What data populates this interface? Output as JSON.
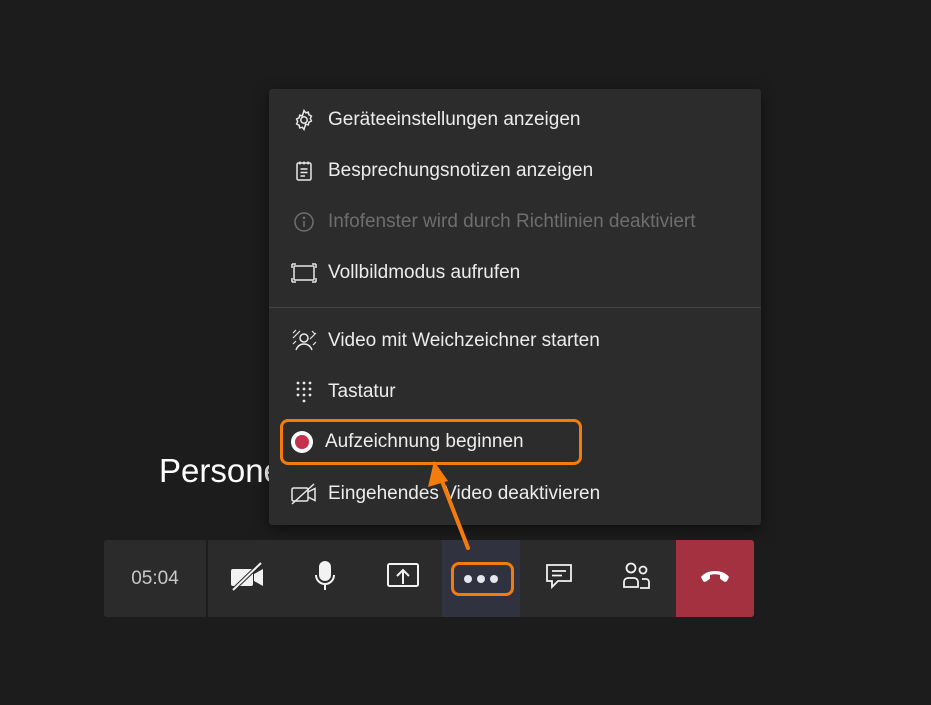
{
  "participant": {
    "name": "Persone"
  },
  "menu": {
    "items": [
      {
        "label": "Geräteeinstellungen anzeigen",
        "icon": "gear-icon",
        "disabled": false
      },
      {
        "label": "Besprechungsnotizen anzeigen",
        "icon": "notes-icon",
        "disabled": false
      },
      {
        "label": "Infofenster wird durch Richtlinien deaktiviert",
        "icon": "info-icon",
        "disabled": true
      },
      {
        "label": "Vollbildmodus aufrufen",
        "icon": "fullscreen-icon",
        "disabled": false
      },
      {
        "label": "Video mit Weichzeichner starten",
        "icon": "blur-background-icon",
        "disabled": false
      },
      {
        "label": "Tastatur",
        "icon": "dialpad-icon",
        "disabled": false
      },
      {
        "label": "Aufzeichnung beginnen",
        "icon": "record-icon",
        "disabled": false
      },
      {
        "label": "Eingehendes Video deaktivieren",
        "icon": "video-off-icon",
        "disabled": false
      }
    ]
  },
  "toolbar": {
    "timer": "05:04",
    "buttons": [
      {
        "name": "camera-toggle",
        "icon": "video-off-icon"
      },
      {
        "name": "microphone",
        "icon": "microphone-icon"
      },
      {
        "name": "share-screen",
        "icon": "share-screen-icon"
      },
      {
        "name": "more-actions",
        "icon": "more-dots-icon"
      },
      {
        "name": "chat",
        "icon": "chat-icon"
      },
      {
        "name": "participants",
        "icon": "participants-icon"
      },
      {
        "name": "hang-up",
        "icon": "phone-hangup-icon"
      }
    ]
  },
  "colors": {
    "background": "#1c1c1c",
    "menu_bg": "#2d2c2c",
    "toolbar_bg": "#2b2b2b",
    "hangup": "#a4313f",
    "record": "#c4314b",
    "annotation": "#f57c0a"
  }
}
